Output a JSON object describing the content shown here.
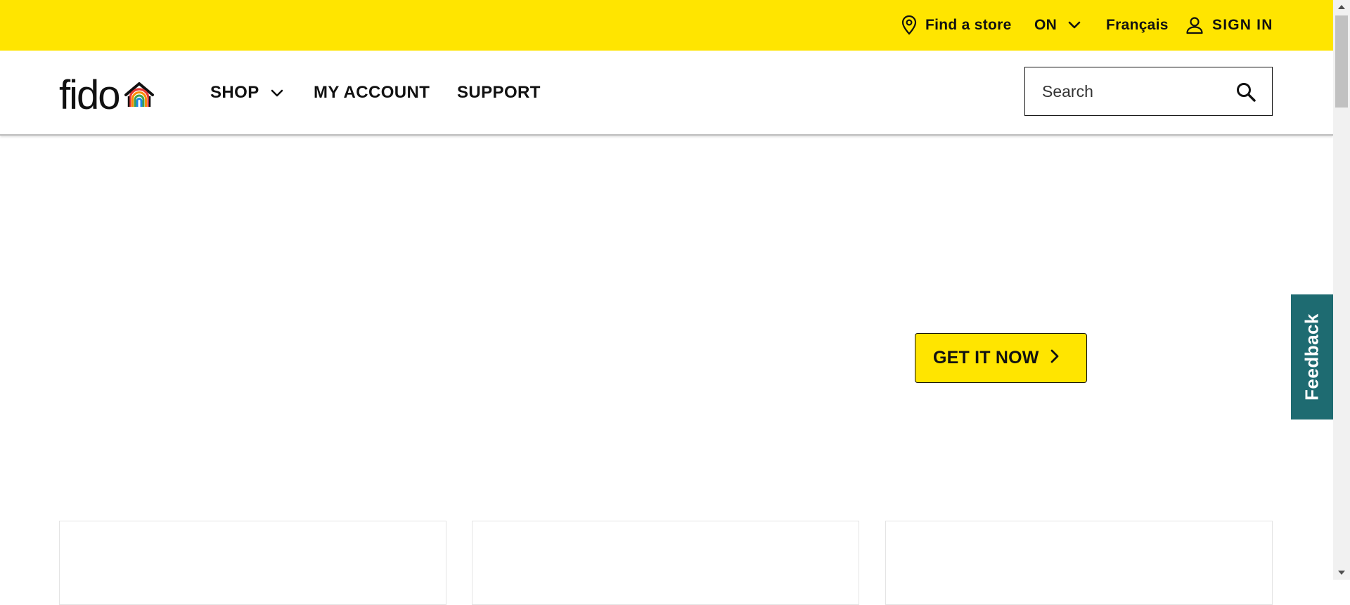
{
  "utility_bar": {
    "find_store_label": "Find a store",
    "province_label": "ON",
    "language_label": "Français",
    "sign_in_label": "SIGN IN",
    "background_color": "#FFE500"
  },
  "header": {
    "logo_text": "fido",
    "nav": {
      "shop_label": "SHOP",
      "my_account_label": "MY ACCOUNT",
      "support_label": "SUPPORT"
    },
    "search": {
      "placeholder": "Search"
    }
  },
  "hero": {
    "cta_label": "GET IT NOW"
  },
  "feedback": {
    "label": "Feedback",
    "background_color": "#1E6B71"
  },
  "icons": {
    "store": "location-pin-icon",
    "province_dropdown": "chevron-down-icon",
    "user": "user-icon",
    "shop_dropdown": "chevron-down-icon",
    "search": "search-icon",
    "cta_arrow": "chevron-right-icon",
    "logo_mark": "rainbow-house-icon"
  },
  "colors": {
    "brand_yellow": "#FFE500",
    "text": "#111111",
    "feedback_teal": "#1E6B71"
  }
}
